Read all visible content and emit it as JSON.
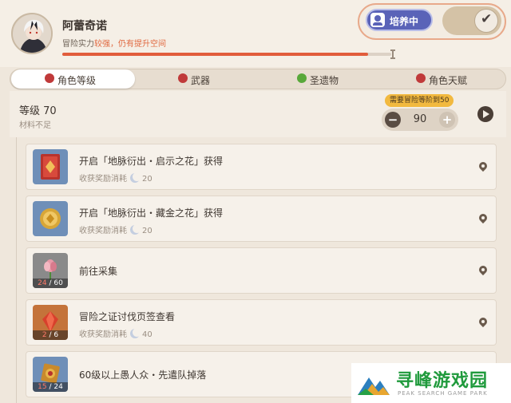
{
  "character": {
    "name": "阿蕾奇诺",
    "adventure_label": "冒险实力",
    "adventure_strength": "较强，仍有提升空间",
    "progress_fraction": 0.93
  },
  "toggle": {
    "train_label": "培养中",
    "enabled": true
  },
  "tabs": [
    {
      "label": "角色等级",
      "active": true,
      "icon": "red-badge-icon"
    },
    {
      "label": "武器",
      "active": false,
      "icon": "red-badge-icon"
    },
    {
      "label": "圣遗物",
      "active": false,
      "icon": "green-check-icon"
    },
    {
      "label": "角色天赋",
      "active": false,
      "icon": "red-badge-icon"
    }
  ],
  "level": {
    "title": "等级 70",
    "status": "材料不足",
    "requirement": "需要冒险等阶到50",
    "target_value": "90"
  },
  "tasks": [
    {
      "title": "开启「地脉衍出・启示之花」获得",
      "reward_label": "收获奖励消耗",
      "reward_value": "20",
      "thumb": "red-book"
    },
    {
      "title": "开启「地脉衍出・藏金之花」获得",
      "reward_label": "收获奖励消耗",
      "reward_value": "20",
      "thumb": "gold-coin"
    },
    {
      "title": "前往采集",
      "count_current": "24",
      "count_total": "/ 60",
      "thumb": "pink-flower"
    },
    {
      "title": "冒险之证讨伐页签查看",
      "reward_label": "收获奖励消耗",
      "reward_value": "40",
      "count_current": "2",
      "count_total": "/ 6",
      "thumb": "red-gem"
    },
    {
      "title": "60级以上愚人众・先遣队掉落",
      "count_current": "15",
      "count_total": "/ 24",
      "thumb": "gold-insignia"
    }
  ],
  "watermark": {
    "name": "寻峰游戏园",
    "subtitle": "PEAK SEARCH GAME PARK"
  },
  "colors": {
    "accent": "#e15d3c",
    "train_button": "#5a63b8",
    "requirement_badge": "#f2b93f",
    "watermark_green": "#1f9a3c"
  }
}
